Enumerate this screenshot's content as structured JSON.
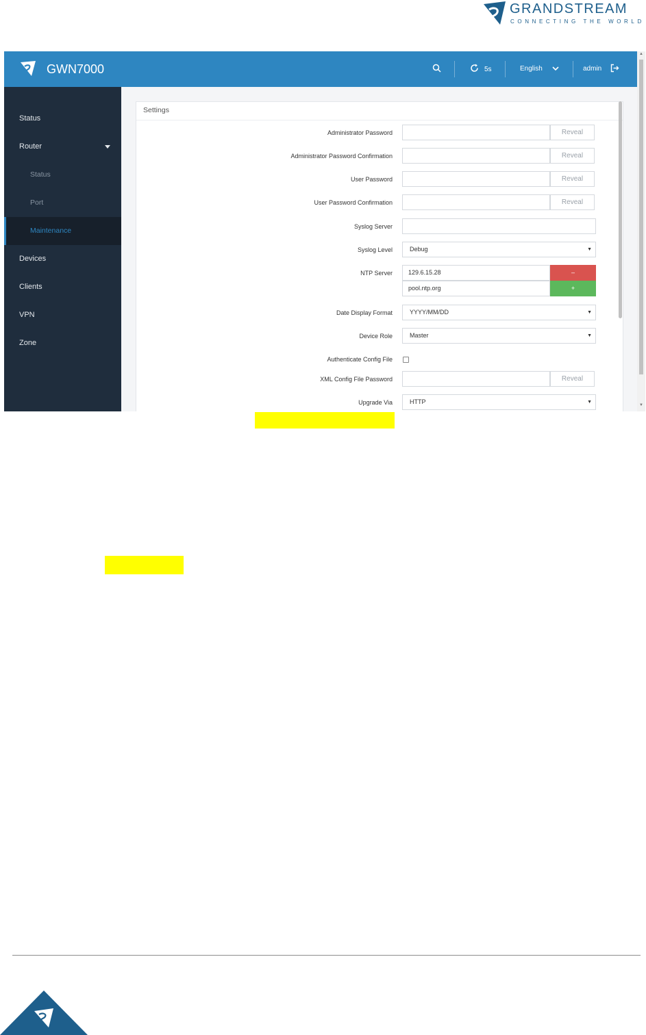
{
  "corporate": {
    "name": "GRANDSTREAM",
    "tagline": "CONNECTING THE WORLD"
  },
  "app": {
    "title": "GWN7000",
    "refresh_interval": "5s",
    "language": "English",
    "user": "admin"
  },
  "sidebar": {
    "items": [
      {
        "label": "Status"
      },
      {
        "label": "Router"
      },
      {
        "label": "Status"
      },
      {
        "label": "Port"
      },
      {
        "label": "Maintenance"
      },
      {
        "label": "Devices"
      },
      {
        "label": "Clients"
      },
      {
        "label": "VPN"
      },
      {
        "label": "Zone"
      }
    ],
    "active": "Maintenance"
  },
  "settings": {
    "title": "Settings",
    "reveal_label": "Reveal",
    "fields": {
      "admin_password": {
        "label": "Administrator Password",
        "value": ""
      },
      "admin_password_confirm": {
        "label": "Administrator Password Confirmation",
        "value": ""
      },
      "user_password": {
        "label": "User Password",
        "value": ""
      },
      "user_password_confirm": {
        "label": "User Password Confirmation",
        "value": ""
      },
      "syslog_server": {
        "label": "Syslog Server",
        "value": ""
      },
      "syslog_level": {
        "label": "Syslog Level",
        "value": "Debug"
      },
      "ntp_server": {
        "label": "NTP Server",
        "servers": [
          "129.6.15.28",
          "pool.ntp.org"
        ],
        "remove_label": "–",
        "add_label": "+"
      },
      "date_format": {
        "label": "Date Display Format",
        "value": "YYYY/MM/DD"
      },
      "device_role": {
        "label": "Device Role",
        "value": "Master"
      },
      "authenticate_config": {
        "label": "Authenticate Config File",
        "checked": false
      },
      "xml_config_password": {
        "label": "XML Config File Password",
        "value": ""
      },
      "upgrade_via": {
        "label": "Upgrade Via",
        "value": "HTTP"
      }
    }
  },
  "colors": {
    "header": "#2e86c1",
    "sidebar": "#1f2d3d",
    "highlight": "#ffff00",
    "remove_button": "#d9534f",
    "add_button": "#5cb85c"
  }
}
